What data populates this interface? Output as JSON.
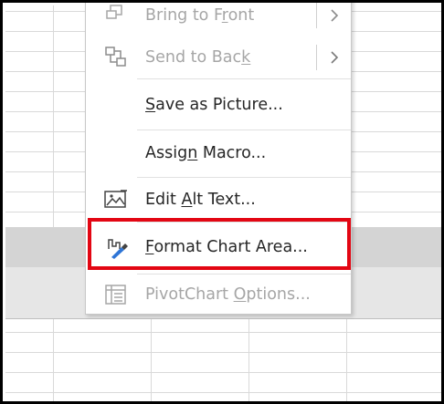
{
  "context_menu": {
    "items": [
      {
        "label_pre": "Bring to F",
        "label_ul": "r",
        "label_post": "ont",
        "disabled": true,
        "submenu": true,
        "icon": "bring-to-front-icon"
      },
      {
        "label_pre": "Send to Bac",
        "label_ul": "k",
        "label_post": "",
        "disabled": true,
        "submenu": true,
        "icon": "send-to-back-icon"
      },
      {
        "label_pre": "",
        "label_ul": "S",
        "label_post": "ave as Picture...",
        "disabled": false,
        "submenu": false,
        "icon": ""
      },
      {
        "label_pre": "Assig",
        "label_ul": "n",
        "label_post": " Macro...",
        "disabled": false,
        "submenu": false,
        "icon": ""
      },
      {
        "label_pre": "Edit ",
        "label_ul": "A",
        "label_post": "lt Text...",
        "disabled": false,
        "submenu": false,
        "icon": "alt-text-icon"
      },
      {
        "label_pre": "",
        "label_ul": "F",
        "label_post": "ormat Chart Area...",
        "disabled": false,
        "submenu": false,
        "icon": "format-chart-area-icon"
      },
      {
        "label_pre": "PivotChart ",
        "label_ul": "O",
        "label_post": "ptions...",
        "disabled": true,
        "submenu": false,
        "icon": "pivotchart-options-icon"
      }
    ],
    "highlighted_item": "Format Chart Area...",
    "highlight_color": "#e30613"
  }
}
